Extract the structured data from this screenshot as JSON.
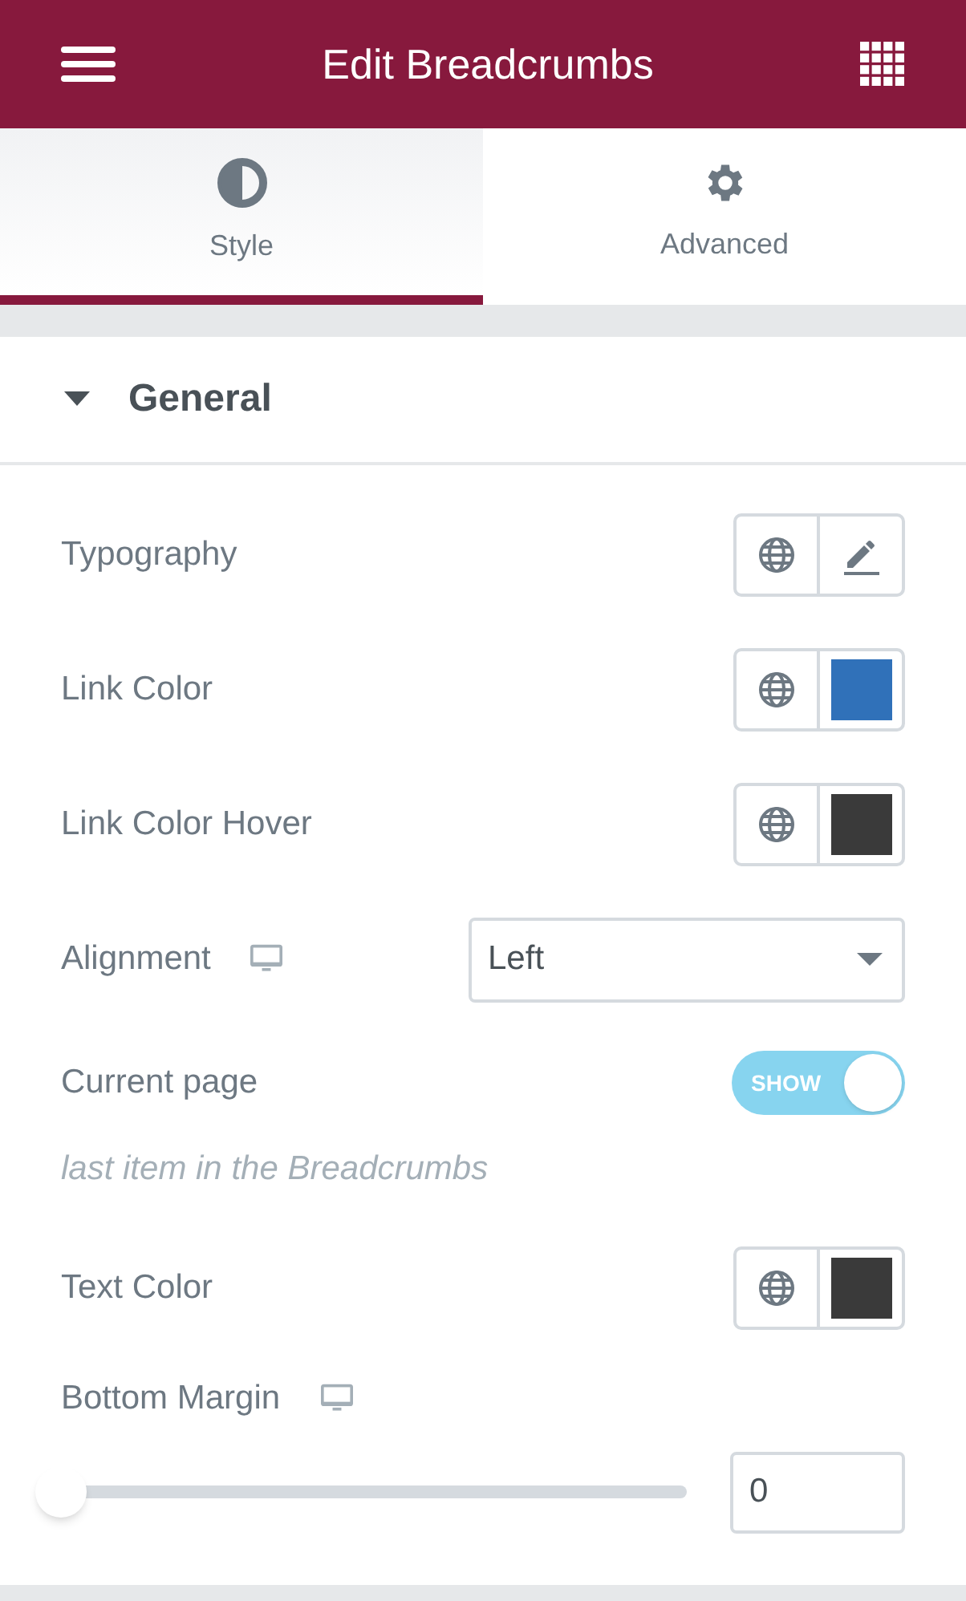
{
  "header": {
    "title": "Edit Breadcrumbs"
  },
  "tabs": [
    {
      "label": "Style",
      "selected": true
    },
    {
      "label": "Advanced",
      "selected": false
    }
  ],
  "section": {
    "title": "General",
    "expanded": true
  },
  "controls": [
    {
      "kind": "typography",
      "label": "Typography"
    },
    {
      "kind": "color",
      "label": "Link Color",
      "color": "#3071b9"
    },
    {
      "kind": "color",
      "label": "Link Color Hover",
      "color": "#3a3a3a"
    },
    {
      "kind": "select",
      "label": "Alignment",
      "responsive": true,
      "value": "Left"
    },
    {
      "kind": "switch",
      "label": "Current page",
      "on": true,
      "on_label": "SHOW"
    },
    {
      "kind": "note",
      "label": "last item in the Breadcrumbs"
    },
    {
      "kind": "color",
      "label": "Text Color",
      "color": "#3a3a3a"
    },
    {
      "kind": "slider",
      "label": "Bottom Margin",
      "responsive": true,
      "level": 0,
      "value": "0"
    }
  ]
}
